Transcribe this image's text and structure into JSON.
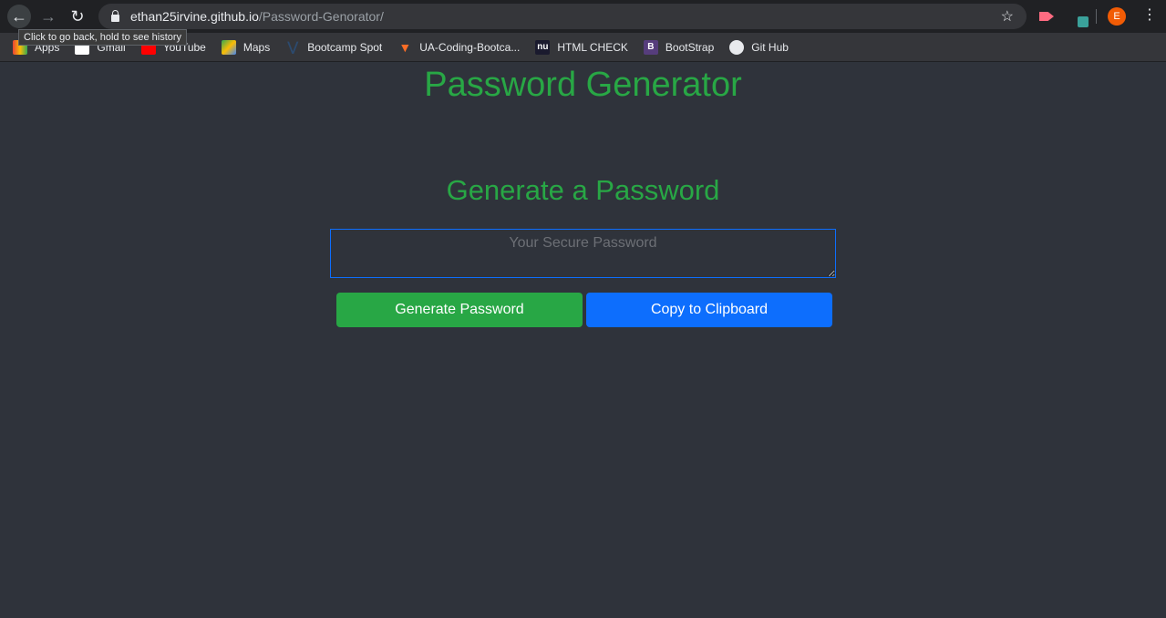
{
  "browser": {
    "url_host": "ethan25irvine.github.io",
    "url_path": "/Password-Genorator/",
    "tooltip": "Click to go back, hold to see history",
    "profile_initial": "E",
    "bookmarks": [
      {
        "label": "Apps",
        "icon": "apps-grid-icon"
      },
      {
        "label": "Gmail",
        "icon": "gmail-icon"
      },
      {
        "label": "YouTube",
        "icon": "youtube-icon"
      },
      {
        "label": "Maps",
        "icon": "maps-icon"
      },
      {
        "label": "Bootcamp Spot",
        "icon": "bootcamp-spot-icon"
      },
      {
        "label": "UA-Coding-Bootca...",
        "icon": "gitlab-icon"
      },
      {
        "label": "HTML CHECK",
        "icon": "nu-validator-icon"
      },
      {
        "label": "BootStrap",
        "icon": "bootstrap-icon"
      },
      {
        "label": "Git Hub",
        "icon": "github-icon"
      }
    ]
  },
  "page": {
    "title": "Password Generator",
    "subtitle": "Generate a Password",
    "password_placeholder": "Your Secure Password",
    "generate_label": "Generate Password",
    "copy_label": "Copy to Clipboard"
  },
  "colors": {
    "green": "#28a745",
    "blue": "#0d6efd",
    "background": "#2f333b"
  }
}
